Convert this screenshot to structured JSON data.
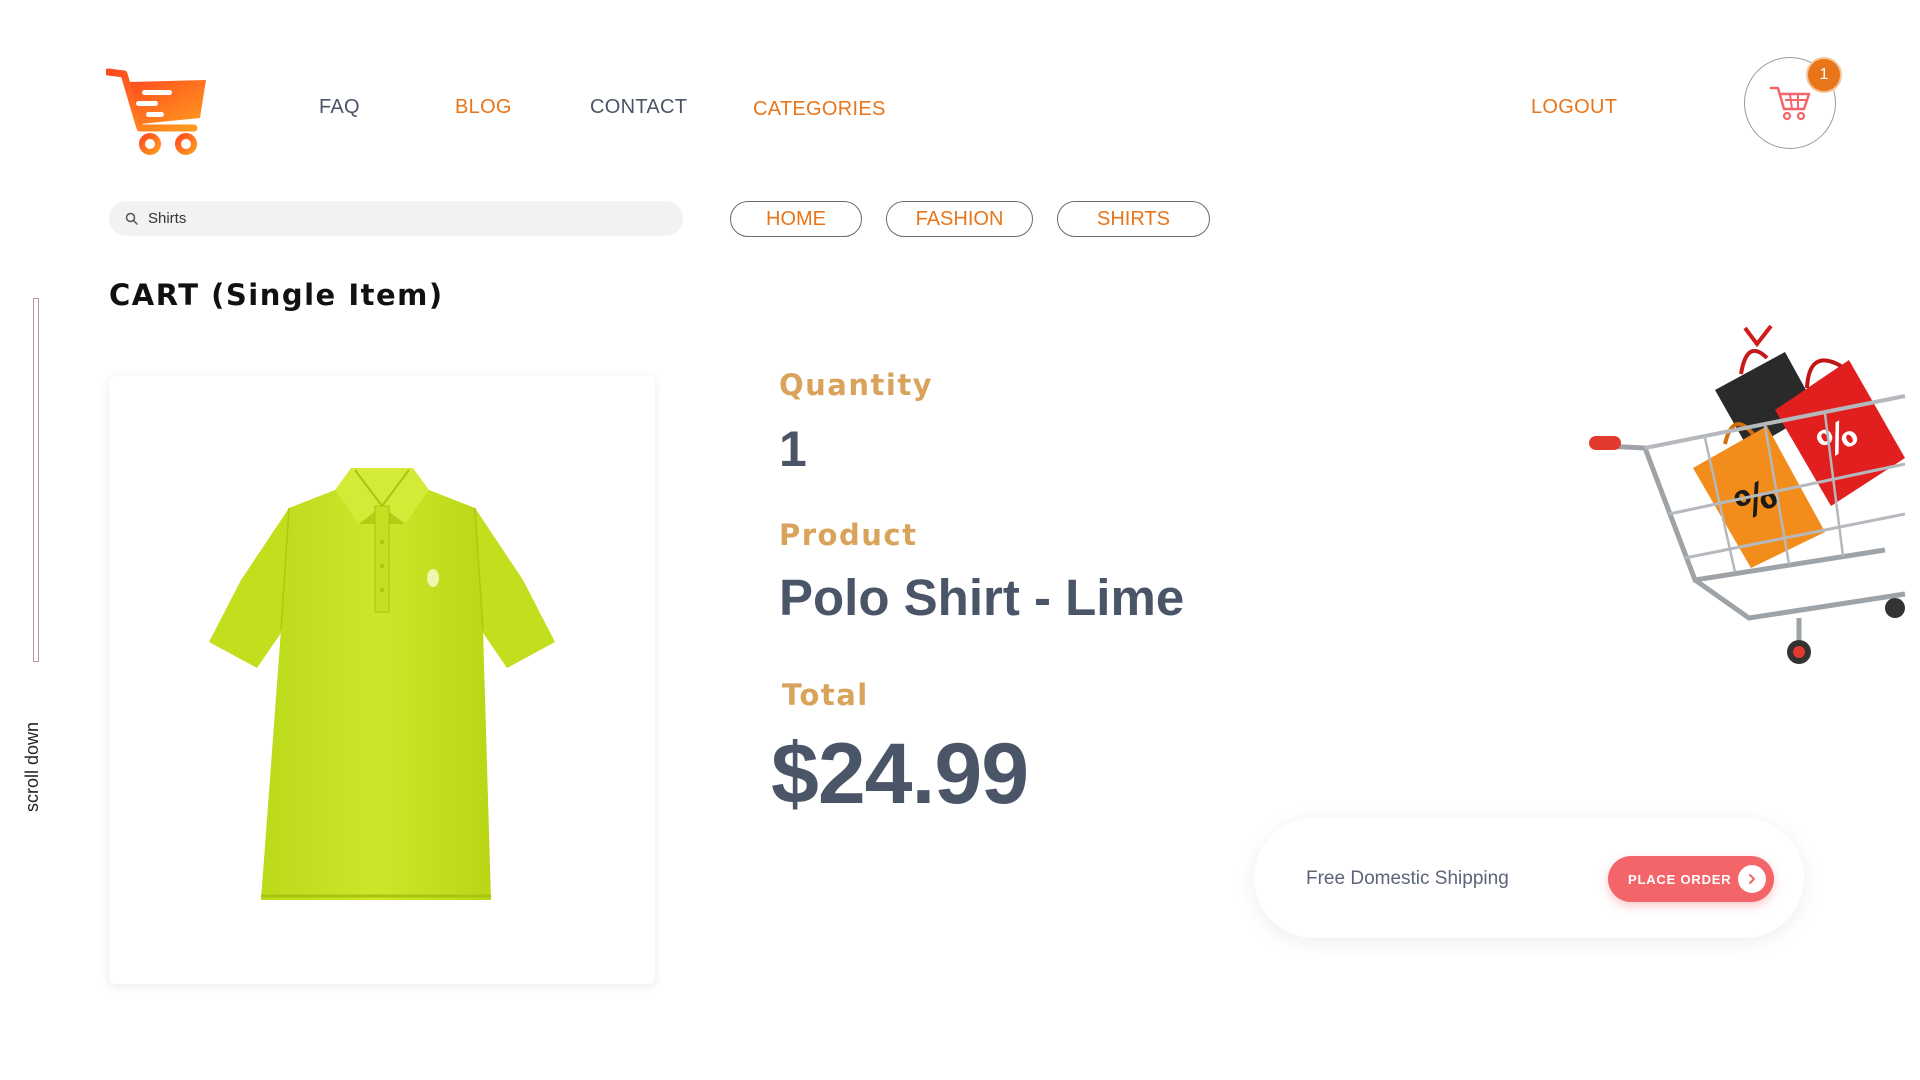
{
  "header": {
    "logo_icon": "shopping-cart-logo",
    "nav": {
      "faq": "FAQ",
      "blog": "BLOG",
      "contact": "CONTACT",
      "categories": "CATEGORIES",
      "logout": "LOGOUT"
    },
    "cart": {
      "icon": "cart-icon",
      "badge_count": "1"
    }
  },
  "search": {
    "value": "Shirts",
    "icon": "search-icon"
  },
  "breadcrumb": [
    "HOME",
    "FASHION",
    "SHIRTS"
  ],
  "page_title": "CART (Single Item)",
  "scroll_hint": "scroll down",
  "item": {
    "quantity_label": "Quantity",
    "quantity": "1",
    "product_label": "Product",
    "product": "Polo Shirt - Lime",
    "total_label": "Total",
    "total": "$24.99"
  },
  "order": {
    "shipping_text": "Free Domestic Shipping",
    "button_label": "PLACE ORDER",
    "button_icon": "chevron-right-icon"
  },
  "colors": {
    "accent_orange": "#e8751a",
    "label_gold": "#d9a35c",
    "text_slate": "#4a5568",
    "button_coral": "#f4656a",
    "shirt_lime": "#c8e11d"
  }
}
